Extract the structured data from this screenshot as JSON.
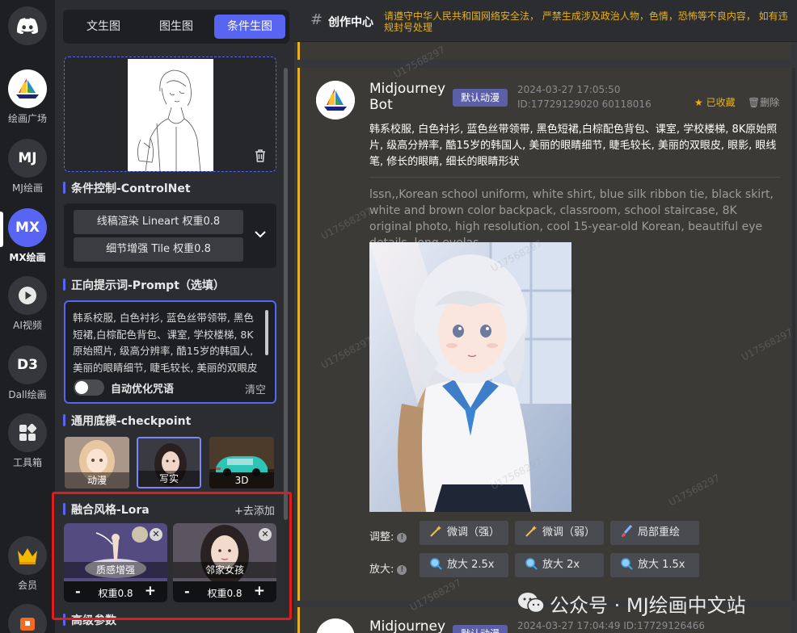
{
  "rail": {
    "items": [
      {
        "label": "绘画广场",
        "icon": "sailboat-logo-icon"
      },
      {
        "label": "MJ绘画",
        "short": "MJ"
      },
      {
        "label": "MX绘画",
        "short": "MX",
        "active": true
      },
      {
        "label": "AI视频",
        "icon": "play-icon"
      },
      {
        "label": "Dall绘画",
        "short": "D3"
      },
      {
        "label": "工具箱",
        "icon": "grid-icon"
      },
      {
        "label": "会员",
        "icon": "crown-icon"
      }
    ]
  },
  "panel": {
    "tabs": [
      "文生图",
      "图生图",
      "条件生图"
    ],
    "active_tab": 2,
    "controlnet": {
      "title": "条件控制-ControlNet",
      "items": [
        "线稿渲染 Lineart 权重0.8",
        "细节增强 Tile 权重0.8"
      ]
    },
    "prompt": {
      "title": "正向提示词-Prompt（选填）",
      "value": "韩系校服, 白色衬衫, 蓝色丝带领带, 黑色短裙,白棕配色背包、课室, 学校楼梯, 8K原始照片, 级高分辨率, 酷15岁的韩国人, 美丽的眼睛细节, 睫毛较长, 美丽的双眼皮",
      "auto_optimize_label": "自动优化咒语",
      "clear_label": "清空"
    },
    "checkpoint": {
      "title": "通用底模-checkpoint",
      "models": [
        "动漫",
        "写实",
        "3D"
      ],
      "selected": 1
    },
    "lora": {
      "title": "融合风格-Lora",
      "add_label": "+去添加",
      "cards": [
        {
          "name": "质感增强",
          "weight_label": "权重0.8"
        },
        {
          "name": "邻家女孩",
          "weight_label": "权重0.8"
        }
      ]
    },
    "advanced_title": "高级参数"
  },
  "main": {
    "header": {
      "title": "创作中心",
      "notice": "请遵守中华人民共和国网络安全法， 严禁生成涉及政治人物，色情，恐怖等不良内容， 如有违规封号处理"
    },
    "card": {
      "bot_name": "Midjourney Bot",
      "badge": "默认动漫",
      "meta": "2024-03-27 17:05:50 ID:17729129020 60118016",
      "fav_label": "已收藏",
      "delete_label": "删除",
      "prompt_cn": "韩系校服, 白色衬衫, 蓝色丝带领带, 黑色短裙,白棕配色背包、课室, 学校楼梯, 8K原始照片, 级高分辨率, 酷15岁的韩国人, 美丽的眼睛细节, 睫毛较长, 美丽的双眼皮, 眼影, 眼线笔, 修长的眼睛, 细长的眼睛形状",
      "prompt_en": "lssn,,Korean school uniform, white shirt, blue silk ribbon tie, black skirt, white and brown color backpack, classroom, school staircase, 8K original photo, high resolution, cool 15-year-old Korean, beautiful eye details, long eyelas...",
      "adjust_label": "调整:",
      "upscale_label": "放大:",
      "adjust_buttons": [
        "微调（强）",
        "微调（弱）",
        "局部重绘"
      ],
      "upscale_buttons": [
        "放大 2.5x",
        "放大 2x",
        "放大 1.5x"
      ]
    },
    "next_card": {
      "bot_name": "Midjourney",
      "badge": "默认动漫",
      "meta": "2024-03-27 17:04:49 ID:17729126466"
    },
    "watermark": "U17568297",
    "wechat_label": "公众号 · MJ绘画中文站"
  },
  "colors": {
    "accent": "#5865f2",
    "warning": "#e8b020",
    "highlight_box": "#e21b1b"
  }
}
